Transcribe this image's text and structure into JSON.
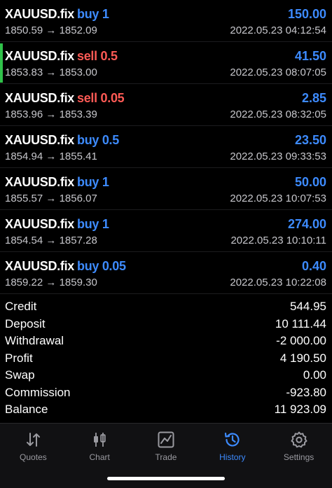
{
  "deals": [
    {
      "symbol": "XAUUSD.fix",
      "side": "buy",
      "volume": "buy 1",
      "open": "1850.59",
      "close": "1852.09",
      "time": "2022.05.23 04:12:54",
      "profit": "150.00",
      "active": false
    },
    {
      "symbol": "XAUUSD.fix",
      "side": "sell",
      "volume": "sell 0.5",
      "open": "1853.83",
      "close": "1853.00",
      "time": "2022.05.23 08:07:05",
      "profit": "41.50",
      "active": true
    },
    {
      "symbol": "XAUUSD.fix",
      "side": "sell",
      "volume": "sell 0.05",
      "open": "1853.96",
      "close": "1853.39",
      "time": "2022.05.23 08:32:05",
      "profit": "2.85",
      "active": false
    },
    {
      "symbol": "XAUUSD.fix",
      "side": "buy",
      "volume": "buy 0.5",
      "open": "1854.94",
      "close": "1855.41",
      "time": "2022.05.23 09:33:53",
      "profit": "23.50",
      "active": false
    },
    {
      "symbol": "XAUUSD.fix",
      "side": "buy",
      "volume": "buy 1",
      "open": "1855.57",
      "close": "1856.07",
      "time": "2022.05.23 10:07:53",
      "profit": "50.00",
      "active": false
    },
    {
      "symbol": "XAUUSD.fix",
      "side": "buy",
      "volume": "buy 1",
      "open": "1854.54",
      "close": "1857.28",
      "time": "2022.05.23 10:10:11",
      "profit": "274.00",
      "active": false
    },
    {
      "symbol": "XAUUSD.fix",
      "side": "buy",
      "volume": "buy 0.05",
      "open": "1859.22",
      "close": "1859.30",
      "time": "2022.05.23 10:22:08",
      "profit": "0.40",
      "active": false
    }
  ],
  "arrow": "→",
  "summary": [
    {
      "label": "Credit",
      "value": "544.95"
    },
    {
      "label": "Deposit",
      "value": "10 111.44"
    },
    {
      "label": "Withdrawal",
      "value": "-2 000.00"
    },
    {
      "label": "Profit",
      "value": "4 190.50"
    },
    {
      "label": "Swap",
      "value": "0.00"
    },
    {
      "label": "Commission",
      "value": "-923.80"
    },
    {
      "label": "Balance",
      "value": "11 923.09"
    }
  ],
  "tabs": [
    {
      "label": "Quotes",
      "icon": "quotes-arrows-icon",
      "selected": false
    },
    {
      "label": "Chart",
      "icon": "candlestick-icon",
      "selected": false
    },
    {
      "label": "Trade",
      "icon": "trade-chart-icon",
      "selected": false
    },
    {
      "label": "History",
      "icon": "history-clock-icon",
      "selected": true
    },
    {
      "label": "Settings",
      "icon": "gear-icon",
      "selected": false
    }
  ],
  "colors": {
    "buy": "#3d8bff",
    "sell": "#ff5a55",
    "accent": "#30c24a",
    "background": "#000000"
  }
}
